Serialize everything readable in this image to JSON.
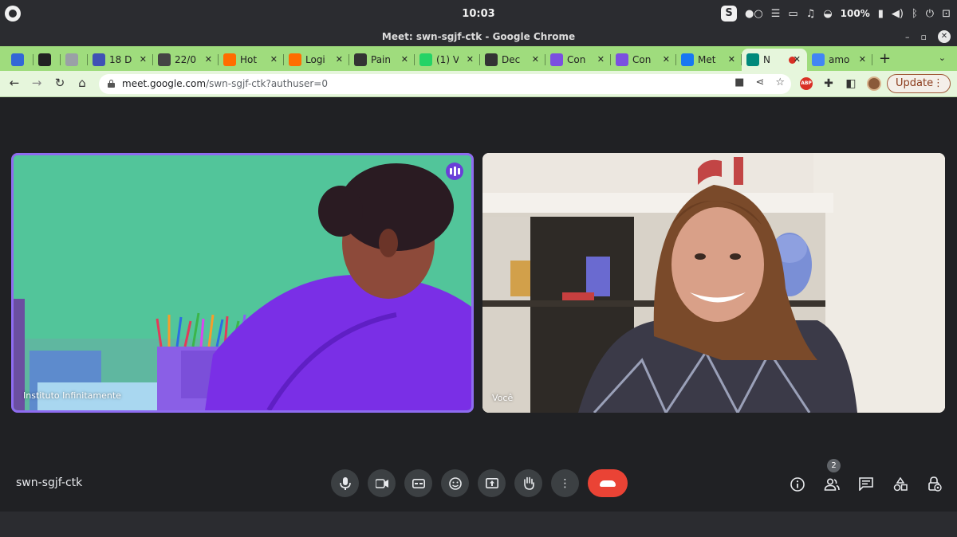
{
  "os": {
    "time": "10:03",
    "tray_s": "S",
    "battery": "100%"
  },
  "window": {
    "title": "Meet: swn-sgjf-ctk - Google Chrome"
  },
  "tabs": [
    {
      "label": "",
      "icon": "analytics-icon",
      "color": "#3367d6"
    },
    {
      "label": "",
      "icon": "pen-icon",
      "color": "#222222"
    },
    {
      "label": "",
      "icon": "circle-icon",
      "color": "#9aa0a6"
    },
    {
      "label": "18 D",
      "icon": "s-icon",
      "color": "#3f51b5"
    },
    {
      "label": "22/0",
      "icon": "info-icon",
      "color": "#444444"
    },
    {
      "label": "Hot",
      "icon": "fire-icon",
      "color": "#ff6d00"
    },
    {
      "label": "Logi",
      "icon": "fire-icon",
      "color": "#ff6d00"
    },
    {
      "label": "Pain",
      "icon": "globe-icon",
      "color": "#333333"
    },
    {
      "label": "(1) V",
      "icon": "whatsapp-icon",
      "color": "#25d366"
    },
    {
      "label": "Dec",
      "icon": "globe-icon",
      "color": "#333333"
    },
    {
      "label": "Con",
      "icon": "pinwheel-icon",
      "color": "#7b4fe0"
    },
    {
      "label": "Con",
      "icon": "pinwheel-icon",
      "color": "#7b4fe0"
    },
    {
      "label": "Met",
      "icon": "meta-icon",
      "color": "#1877f2"
    },
    {
      "label": "N",
      "icon": "meet-icon",
      "color": "#00897b",
      "active": true
    },
    {
      "label": "amo",
      "icon": "google-icon",
      "color": "#4285f4"
    }
  ],
  "address": {
    "host": "meet.google.com",
    "path": "/swn-sgjf-ctk?authuser=0"
  },
  "toolbar": {
    "update_label": "Update",
    "abp_label": "ABP"
  },
  "meeting": {
    "code": "swn-sgjf-ctk",
    "participants": [
      {
        "name": "Instituto Infinitamente",
        "speaking": true
      },
      {
        "name": "Você",
        "speaking": false
      }
    ],
    "people_count": "2"
  },
  "colors": {
    "tab_strip": "#9fdc7d",
    "toolbar": "#e6f6dc",
    "stage": "#202124",
    "speaking_border": "#8e6cf0",
    "end_call": "#ea4335"
  }
}
